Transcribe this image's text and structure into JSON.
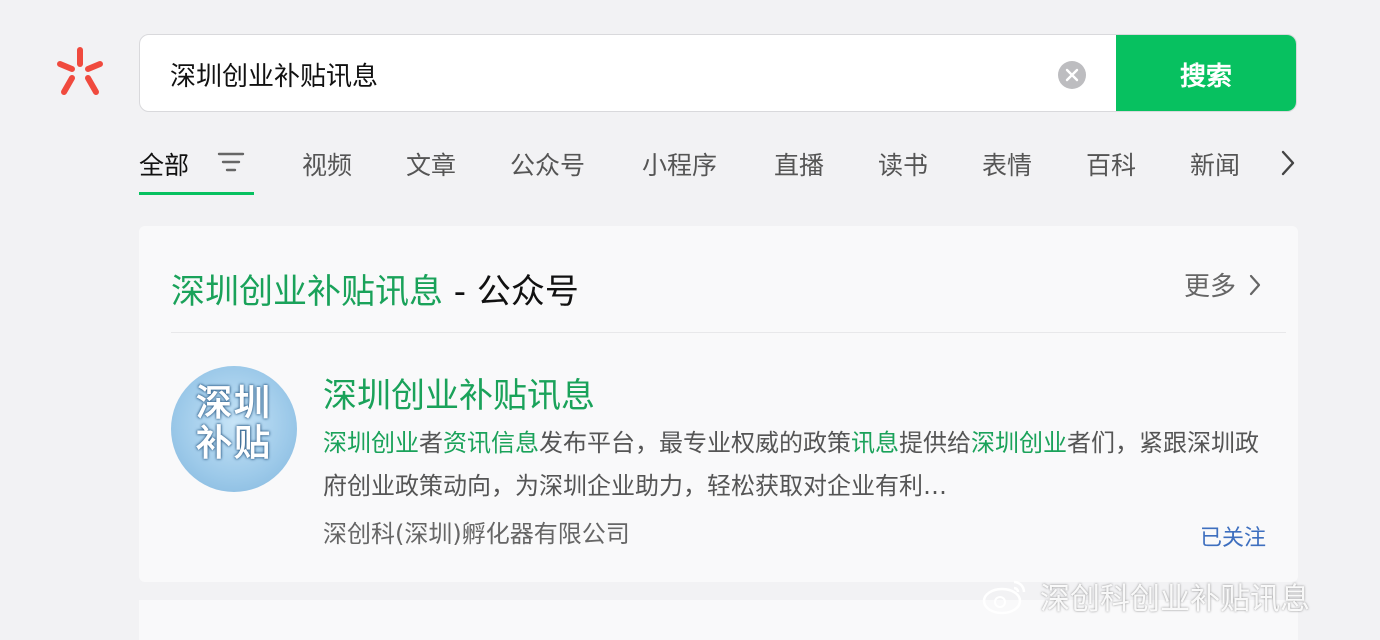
{
  "search": {
    "query": "深圳创业补贴讯息",
    "button_label": "搜索"
  },
  "tabs": [
    {
      "label": "全部",
      "active": true
    },
    {
      "label": "视频"
    },
    {
      "label": "文章"
    },
    {
      "label": "公众号"
    },
    {
      "label": "小程序"
    },
    {
      "label": "直播"
    },
    {
      "label": "读书"
    },
    {
      "label": "表情"
    },
    {
      "label": "百科"
    },
    {
      "label": "新闻"
    }
  ],
  "section": {
    "title_keyword": "深圳创业补贴讯息",
    "title_sep": " - ",
    "title_type": "公众号",
    "more_label": "更多"
  },
  "result": {
    "avatar_text": "深圳补贴",
    "name": "深圳创业补贴讯息",
    "desc_parts": [
      "深圳创业",
      "者",
      "资讯信息",
      "发布平台，最专业权威的政策",
      "讯息",
      "提供给",
      "深圳创业",
      "者们，紧跟深圳政府创业政策动向，为深圳企业助力，轻松获取对企业有利…"
    ],
    "owner": "深创科(深圳)孵化器有限公司",
    "follow_label": "已关注"
  },
  "watermark": "深创科创业补贴讯息",
  "colors": {
    "accent": "#07c160",
    "highlight": "#1aa25a",
    "link": "#3e6fbf",
    "logo": "#f04a3e"
  }
}
